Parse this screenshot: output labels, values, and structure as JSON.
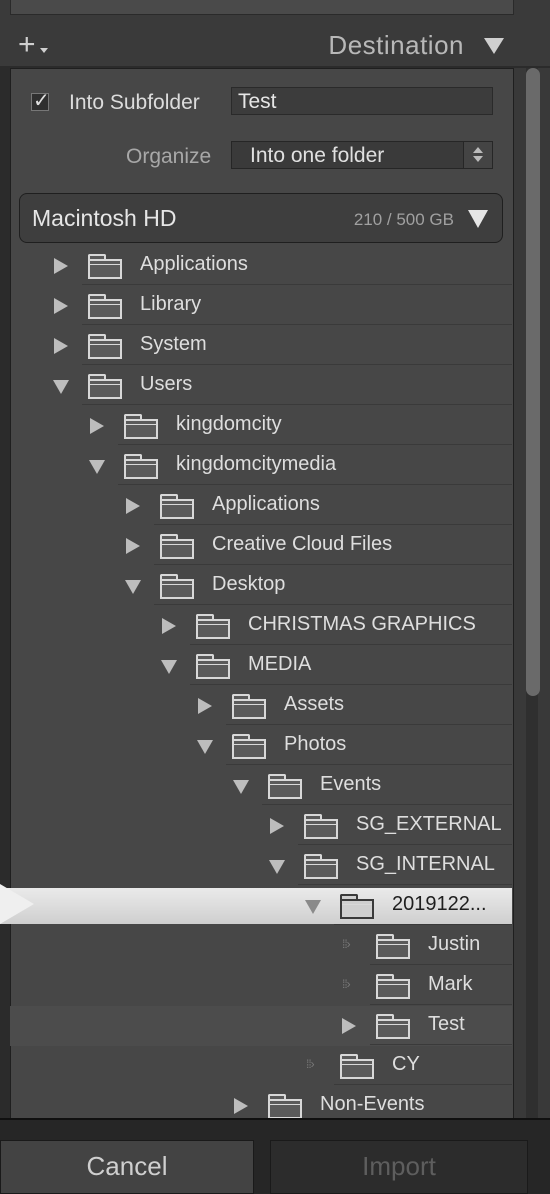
{
  "header": {
    "title": "Destination"
  },
  "options": {
    "into_subfolder_label": "Into Subfolder",
    "into_subfolder_checked": true,
    "subfolder_value": "Test",
    "organize_label": "Organize",
    "organize_value": "Into one folder"
  },
  "volume": {
    "name": "Macintosh HD",
    "size": "210 / 500 GB"
  },
  "tree": [
    {
      "label": "Applications",
      "state": "collapsed"
    },
    {
      "label": "Library",
      "state": "collapsed"
    },
    {
      "label": "System",
      "state": "collapsed"
    },
    {
      "label": "Users",
      "state": "expanded"
    },
    {
      "label": "kingdomcity",
      "state": "collapsed"
    },
    {
      "label": "kingdomcitymedia",
      "state": "expanded"
    },
    {
      "label": "Applications",
      "state": "collapsed"
    },
    {
      "label": "Creative Cloud Files",
      "state": "collapsed"
    },
    {
      "label": "Desktop",
      "state": "expanded"
    },
    {
      "label": "CHRISTMAS GRAPHICS",
      "state": "collapsed"
    },
    {
      "label": "MEDIA",
      "state": "expanded"
    },
    {
      "label": "Assets",
      "state": "collapsed"
    },
    {
      "label": "Photos",
      "state": "expanded"
    },
    {
      "label": "Events",
      "state": "expanded"
    },
    {
      "label": "SG_EXTERNAL",
      "state": "collapsed"
    },
    {
      "label": "SG_INTERNAL",
      "state": "expanded"
    },
    {
      "label": "2019122...",
      "state": "expanded",
      "selected": true
    },
    {
      "label": "Justin",
      "state": "empty"
    },
    {
      "label": "Mark",
      "state": "empty"
    },
    {
      "label": "Test",
      "state": "collapsed"
    },
    {
      "label": "CY",
      "state": "empty"
    },
    {
      "label": "Non-Events",
      "state": "collapsed"
    }
  ],
  "buttons": {
    "cancel": "Cancel",
    "import": "Import"
  },
  "colors": {
    "panel": "#474747",
    "selected": "#e2e2e2",
    "text": "#dedede"
  }
}
